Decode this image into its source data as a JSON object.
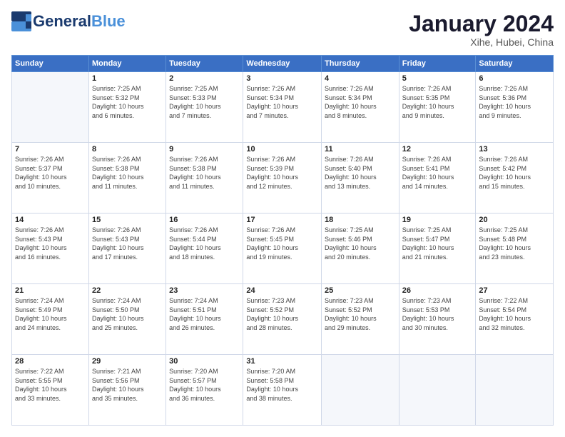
{
  "header": {
    "logo_line1": "General",
    "logo_line2": "Blue",
    "month_title": "January 2024",
    "location": "Xihe, Hubei, China"
  },
  "weekdays": [
    "Sunday",
    "Monday",
    "Tuesday",
    "Wednesday",
    "Thursday",
    "Friday",
    "Saturday"
  ],
  "weeks": [
    [
      {
        "day": "",
        "info": ""
      },
      {
        "day": "1",
        "info": "Sunrise: 7:25 AM\nSunset: 5:32 PM\nDaylight: 10 hours\nand 6 minutes."
      },
      {
        "day": "2",
        "info": "Sunrise: 7:25 AM\nSunset: 5:33 PM\nDaylight: 10 hours\nand 7 minutes."
      },
      {
        "day": "3",
        "info": "Sunrise: 7:26 AM\nSunset: 5:34 PM\nDaylight: 10 hours\nand 7 minutes."
      },
      {
        "day": "4",
        "info": "Sunrise: 7:26 AM\nSunset: 5:34 PM\nDaylight: 10 hours\nand 8 minutes."
      },
      {
        "day": "5",
        "info": "Sunrise: 7:26 AM\nSunset: 5:35 PM\nDaylight: 10 hours\nand 9 minutes."
      },
      {
        "day": "6",
        "info": "Sunrise: 7:26 AM\nSunset: 5:36 PM\nDaylight: 10 hours\nand 9 minutes."
      }
    ],
    [
      {
        "day": "7",
        "info": "Sunrise: 7:26 AM\nSunset: 5:37 PM\nDaylight: 10 hours\nand 10 minutes."
      },
      {
        "day": "8",
        "info": "Sunrise: 7:26 AM\nSunset: 5:38 PM\nDaylight: 10 hours\nand 11 minutes."
      },
      {
        "day": "9",
        "info": "Sunrise: 7:26 AM\nSunset: 5:38 PM\nDaylight: 10 hours\nand 11 minutes."
      },
      {
        "day": "10",
        "info": "Sunrise: 7:26 AM\nSunset: 5:39 PM\nDaylight: 10 hours\nand 12 minutes."
      },
      {
        "day": "11",
        "info": "Sunrise: 7:26 AM\nSunset: 5:40 PM\nDaylight: 10 hours\nand 13 minutes."
      },
      {
        "day": "12",
        "info": "Sunrise: 7:26 AM\nSunset: 5:41 PM\nDaylight: 10 hours\nand 14 minutes."
      },
      {
        "day": "13",
        "info": "Sunrise: 7:26 AM\nSunset: 5:42 PM\nDaylight: 10 hours\nand 15 minutes."
      }
    ],
    [
      {
        "day": "14",
        "info": "Sunrise: 7:26 AM\nSunset: 5:43 PM\nDaylight: 10 hours\nand 16 minutes."
      },
      {
        "day": "15",
        "info": "Sunrise: 7:26 AM\nSunset: 5:43 PM\nDaylight: 10 hours\nand 17 minutes."
      },
      {
        "day": "16",
        "info": "Sunrise: 7:26 AM\nSunset: 5:44 PM\nDaylight: 10 hours\nand 18 minutes."
      },
      {
        "day": "17",
        "info": "Sunrise: 7:26 AM\nSunset: 5:45 PM\nDaylight: 10 hours\nand 19 minutes."
      },
      {
        "day": "18",
        "info": "Sunrise: 7:25 AM\nSunset: 5:46 PM\nDaylight: 10 hours\nand 20 minutes."
      },
      {
        "day": "19",
        "info": "Sunrise: 7:25 AM\nSunset: 5:47 PM\nDaylight: 10 hours\nand 21 minutes."
      },
      {
        "day": "20",
        "info": "Sunrise: 7:25 AM\nSunset: 5:48 PM\nDaylight: 10 hours\nand 23 minutes."
      }
    ],
    [
      {
        "day": "21",
        "info": "Sunrise: 7:24 AM\nSunset: 5:49 PM\nDaylight: 10 hours\nand 24 minutes."
      },
      {
        "day": "22",
        "info": "Sunrise: 7:24 AM\nSunset: 5:50 PM\nDaylight: 10 hours\nand 25 minutes."
      },
      {
        "day": "23",
        "info": "Sunrise: 7:24 AM\nSunset: 5:51 PM\nDaylight: 10 hours\nand 26 minutes."
      },
      {
        "day": "24",
        "info": "Sunrise: 7:23 AM\nSunset: 5:52 PM\nDaylight: 10 hours\nand 28 minutes."
      },
      {
        "day": "25",
        "info": "Sunrise: 7:23 AM\nSunset: 5:52 PM\nDaylight: 10 hours\nand 29 minutes."
      },
      {
        "day": "26",
        "info": "Sunrise: 7:23 AM\nSunset: 5:53 PM\nDaylight: 10 hours\nand 30 minutes."
      },
      {
        "day": "27",
        "info": "Sunrise: 7:22 AM\nSunset: 5:54 PM\nDaylight: 10 hours\nand 32 minutes."
      }
    ],
    [
      {
        "day": "28",
        "info": "Sunrise: 7:22 AM\nSunset: 5:55 PM\nDaylight: 10 hours\nand 33 minutes."
      },
      {
        "day": "29",
        "info": "Sunrise: 7:21 AM\nSunset: 5:56 PM\nDaylight: 10 hours\nand 35 minutes."
      },
      {
        "day": "30",
        "info": "Sunrise: 7:20 AM\nSunset: 5:57 PM\nDaylight: 10 hours\nand 36 minutes."
      },
      {
        "day": "31",
        "info": "Sunrise: 7:20 AM\nSunset: 5:58 PM\nDaylight: 10 hours\nand 38 minutes."
      },
      {
        "day": "",
        "info": ""
      },
      {
        "day": "",
        "info": ""
      },
      {
        "day": "",
        "info": ""
      }
    ]
  ]
}
